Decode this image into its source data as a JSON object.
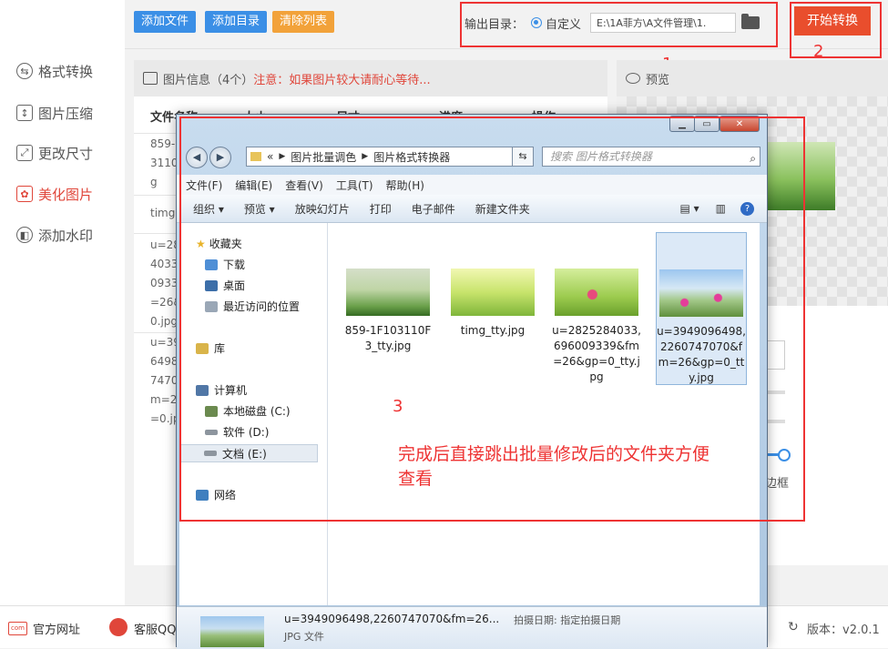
{
  "toolbar": {
    "add_file": "添加文件",
    "add_dir": "添加目录",
    "clear_list": "清除列表",
    "output_dir_label": "输出目录：",
    "custom_label": "自定义",
    "output_path": "E:\\1A菲方\\A文件管理\\1.",
    "start_button": "开始转换"
  },
  "sidebar": {
    "items": [
      {
        "label": "格式转换"
      },
      {
        "label": "图片压缩"
      },
      {
        "label": "更改尺寸"
      },
      {
        "label": "美化图片"
      },
      {
        "label": "添加水印"
      }
    ]
  },
  "info": {
    "title": "图片信息（4个）",
    "warning": "注意：如果图片较大请耐心等待..."
  },
  "table": {
    "headers": [
      "文件名称",
      "大小",
      "尺寸",
      "进度",
      "操作"
    ],
    "rows": [
      {
        "name": "859-\n3110\ng"
      },
      {
        "name": "timg"
      },
      {
        "name": "u=28\n4033\n0933\n=26&\n0.jpg"
      },
      {
        "name": "u=39\n6498\n7470\nm=2\n=0.jp"
      }
    ]
  },
  "preview": {
    "title": "预览",
    "side_label": "边框"
  },
  "annotations": {
    "label1": "1",
    "label2": "2",
    "label3": "3",
    "note": "完成后直接跳出批量修改后的文件夹方便查看"
  },
  "explorer": {
    "breadcrumb": [
      "«",
      "图片批量调色",
      "图片格式转换器"
    ],
    "search_placeholder": "搜索 图片格式转换器",
    "menu": [
      "文件(F)",
      "编辑(E)",
      "查看(V)",
      "工具(T)",
      "帮助(H)"
    ],
    "commands": [
      "组织 ▾",
      "预览 ▾",
      "放映幻灯片",
      "打印",
      "电子邮件",
      "新建文件夹"
    ],
    "nav": {
      "favorites": "收藏夹",
      "downloads": "下载",
      "desktop": "桌面",
      "recent": "最近访问的位置",
      "library": "库",
      "computer": "计算机",
      "drive_c": "本地磁盘 (C:)",
      "drive_d": "软件 (D:)",
      "drive_e": "文档 (E:)",
      "network": "网络"
    },
    "files": [
      {
        "name": "859-1F103110F3_tty.jpg"
      },
      {
        "name": "timg_tty.jpg"
      },
      {
        "name": "u=2825284033,696009339&fm=26&gp=0_tty.jpg"
      },
      {
        "name": "u=3949096498,2260747070&fm=26&gp=0_tty.jpg"
      }
    ],
    "details": {
      "name": "u=3949096498,2260747070&fm=26...",
      "date_label": "拍摄日期: 指定拍摄日期",
      "type": "JPG 文件"
    }
  },
  "bottom": {
    "website": "官方网址",
    "support": "客服QQ",
    "version": "版本：v2.0.1"
  }
}
